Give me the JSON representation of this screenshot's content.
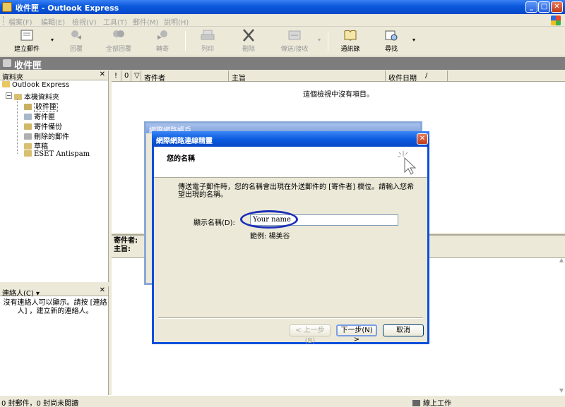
{
  "window": {
    "title": "收件匣 - Outlook Express",
    "buttons": {
      "minimize": "_",
      "maximize": "□",
      "close": "✕"
    }
  },
  "menu": [
    {
      "label": "檔案(F)"
    },
    {
      "label": "編輯(E)"
    },
    {
      "label": "檢視(V)"
    },
    {
      "label": "工具(T)"
    },
    {
      "label": "郵件(M)"
    },
    {
      "label": "說明(H)"
    }
  ],
  "toolbar": {
    "new_mail": "建立郵件",
    "reply": "回覆",
    "reply_all": "全部回覆",
    "forward": "轉寄",
    "print": "列印",
    "delete": "刪除",
    "send_receive": "傳送/接收",
    "addresses": "通訊錄",
    "find": "尋找"
  },
  "folder_header": {
    "title": "收件匣"
  },
  "folders_pane": {
    "title": "資料夾",
    "close": "✕",
    "root": "Outlook Express",
    "local": "本機資料夾",
    "items": [
      {
        "label": "收件匣"
      },
      {
        "label": "寄件匣"
      },
      {
        "label": "寄件備份"
      },
      {
        "label": "刪除的郵件"
      },
      {
        "label": "草稿"
      },
      {
        "label": "ESET Antispam"
      }
    ]
  },
  "contacts_pane": {
    "title": "連絡人(C) ▾",
    "close": "✕",
    "message": "沒有連絡人可以顯示。請按 [連絡人] ，建立新的連絡人。"
  },
  "message_list": {
    "columns": [
      "!",
      "0",
      "▽",
      "寄件者",
      "主旨",
      "收件日期",
      "/"
    ],
    "empty_text": "這個檢視中沒有項目。"
  },
  "preview": {
    "from_label": "寄件者:",
    "subject_label": "主旨:"
  },
  "statusbar": {
    "left": "0 封郵件，0 封尚未閱讀",
    "right": "線上工作"
  },
  "bg_dialog": {
    "title": "網際網路帳戶"
  },
  "wizard": {
    "title": "網際網路連線精靈",
    "close": "✕",
    "heading": "您的名稱",
    "description": "傳送電子郵件時，您的名稱會出現在外送郵件的 [寄件者] 欄位。請輸入您希望出現的名稱。",
    "field_label": "顯示名稱(D):",
    "field_value": "Your name",
    "example": "範例: 楊美谷",
    "back": "< 上一步(B)",
    "next": "下一步(N) >",
    "cancel": "取消"
  }
}
